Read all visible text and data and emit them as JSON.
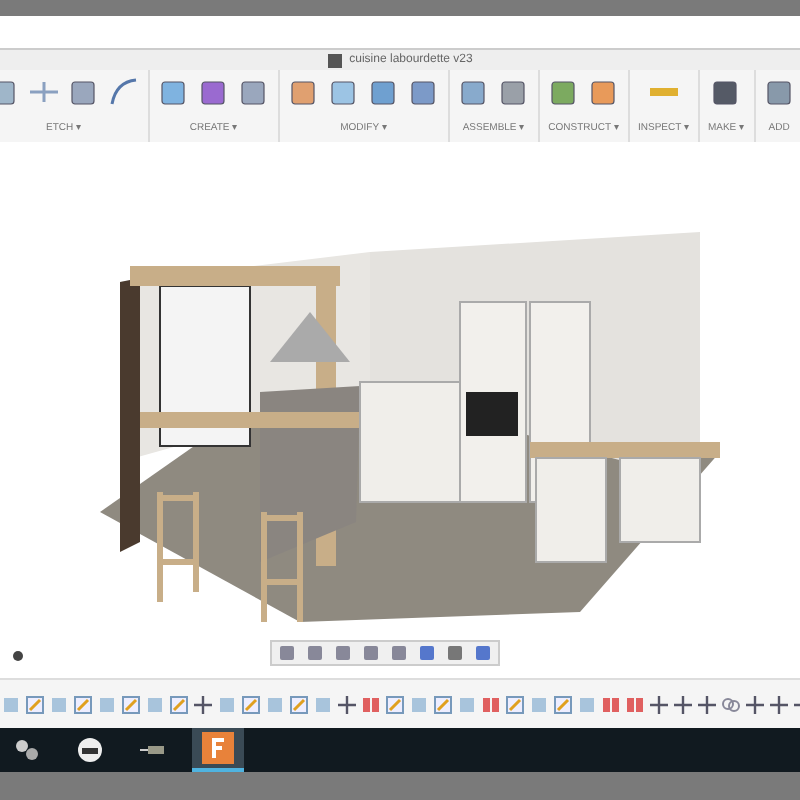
{
  "window": {
    "title": "cuisine labourdette v23"
  },
  "toolbar": [
    {
      "label": "ETCH ▾"
    },
    {
      "label": "CREATE ▾"
    },
    {
      "label": "MODIFY ▾"
    },
    {
      "label": "ASSEMBLE ▾"
    },
    {
      "label": "CONSTRUCT ▾"
    },
    {
      "label": "INSPECT ▾"
    },
    {
      "label": "MAKE ▾"
    },
    {
      "label": "ADD"
    }
  ]
}
